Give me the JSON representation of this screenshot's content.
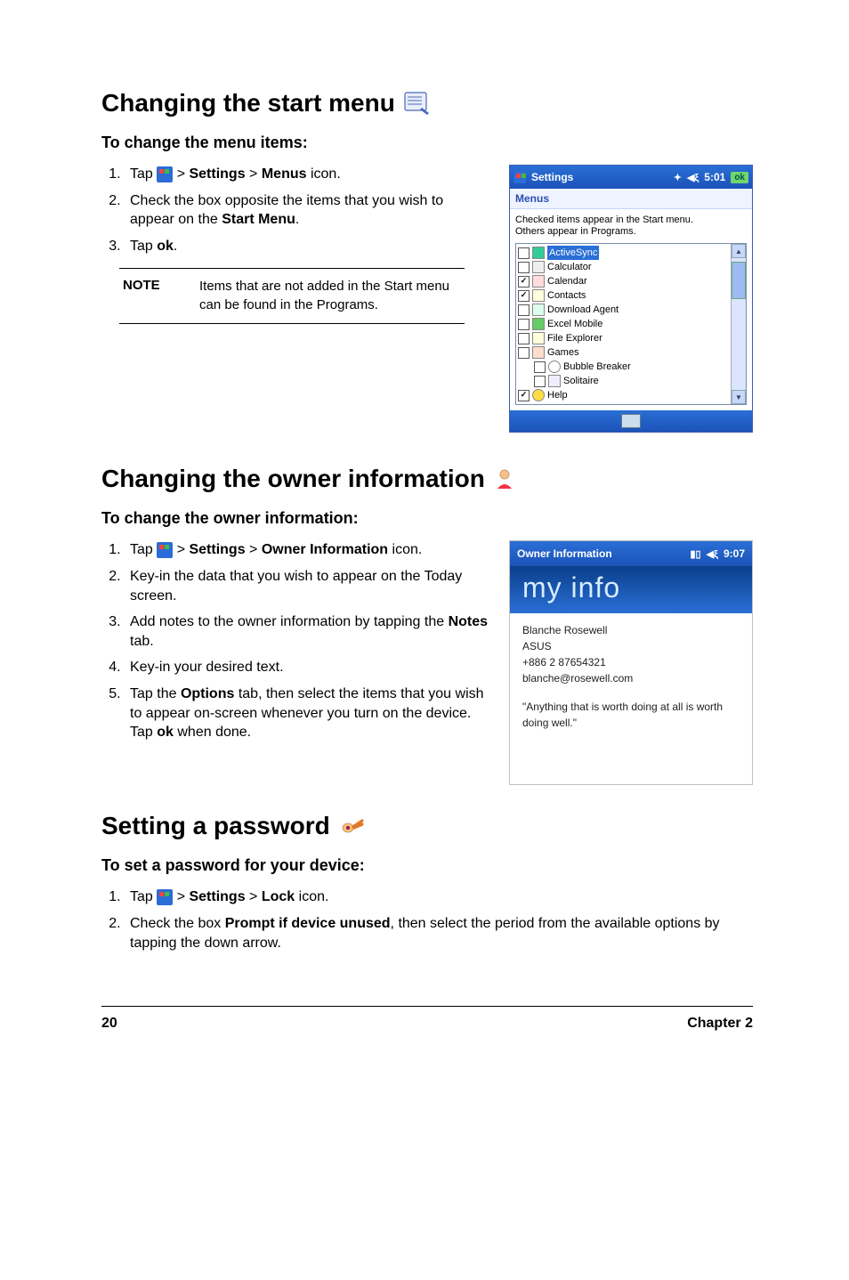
{
  "section1": {
    "title": "Changing the start menu",
    "subtitle": "To change the menu items:",
    "steps": [
      {
        "pre": "Tap ",
        "post": " > ",
        "b1": "Settings",
        "mid": " > ",
        "b2": "Menus",
        "tail": " icon."
      },
      {
        "pre": "Check the box opposite the items that you wish to appear on the ",
        "b1": "Start Menu",
        "tail": "."
      },
      {
        "pre": "Tap ",
        "b1": "ok",
        "tail": "."
      }
    ],
    "note_label": "NOTE",
    "note_text": "Items that are not added in the Start menu can be found in the Programs."
  },
  "section2": {
    "title": "Changing the owner information",
    "subtitle": "To change the owner information:",
    "steps": [
      {
        "pre": "Tap ",
        "post": " > ",
        "b1": "Settings",
        "mid": " > ",
        "b2": "Owner Information",
        "tail": " icon."
      },
      {
        "text": "Key-in the data that you wish to appear on the Today screen."
      },
      {
        "pre": "Add notes to the owner information by tapping the ",
        "b1": "Notes",
        "tail": " tab."
      },
      {
        "text": "Key-in your desired text."
      },
      {
        "pre": "Tap the ",
        "b1": "Options",
        "mid": " tab, then select the items that you wish to appear on-screen whenever you turn on the device. Tap ",
        "b2": "ok",
        "tail": " when done."
      }
    ]
  },
  "section3": {
    "title": "Setting a password",
    "subtitle": "To set a password for your device:",
    "steps": [
      {
        "pre": "Tap ",
        "post": " > ",
        "b1": "Settings",
        "mid": " > ",
        "b2": "Lock",
        "tail": " icon."
      },
      {
        "pre": "Check the box ",
        "b1": "Prompt if device unused",
        "tail": ", then select the period from the available options by tapping the down arrow."
      }
    ]
  },
  "shot1": {
    "title": "Settings",
    "time": "5:01",
    "ok": "ok",
    "tab": "Menus",
    "desc1": "Checked items appear in the Start menu.",
    "desc2": "Others appear in Programs.",
    "items": [
      {
        "label": "ActiveSync",
        "checked": false,
        "icon": "sync",
        "selected": true
      },
      {
        "label": "Calculator",
        "checked": false,
        "icon": "calc"
      },
      {
        "label": "Calendar",
        "checked": true,
        "icon": "cal"
      },
      {
        "label": "Contacts",
        "checked": true,
        "icon": "cont"
      },
      {
        "label": "Download Agent",
        "checked": false,
        "icon": "dl"
      },
      {
        "label": "Excel Mobile",
        "checked": false,
        "icon": "xls"
      },
      {
        "label": "File Explorer",
        "checked": false,
        "icon": "fe"
      },
      {
        "label": "Games",
        "checked": false,
        "icon": "games"
      },
      {
        "label": "Bubble Breaker",
        "checked": false,
        "icon": "bub",
        "indent": true
      },
      {
        "label": "Solitaire",
        "checked": false,
        "icon": "sol",
        "indent": true
      },
      {
        "label": "Help",
        "checked": true,
        "icon": "help"
      }
    ]
  },
  "shot2": {
    "title": "Owner Information",
    "time": "9:07",
    "header": "my info",
    "name": "Blanche Rosewell",
    "company": "ASUS",
    "phone": "+886 2 87654321",
    "email": "blanche@rosewell.com",
    "quote": "\"Anything that is worth doing at all is worth doing well.\""
  },
  "footer": {
    "page": "20",
    "chapter": "Chapter 2"
  }
}
